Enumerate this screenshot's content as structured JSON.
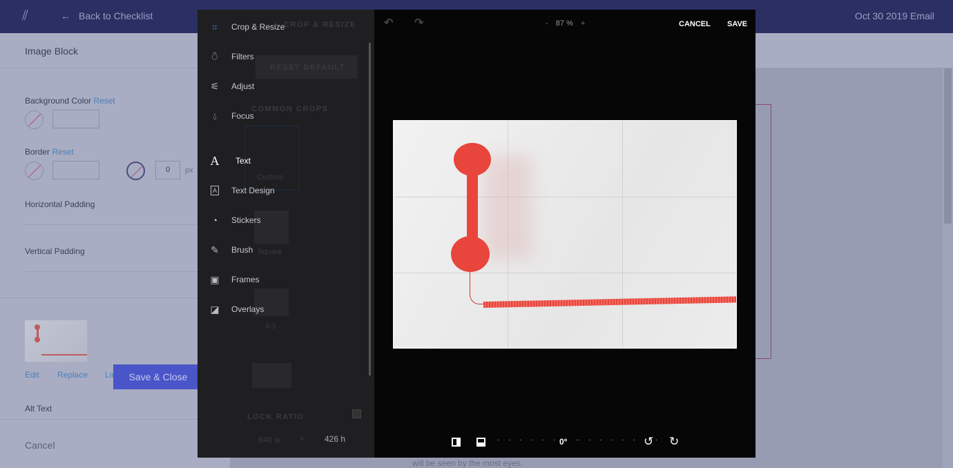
{
  "header": {
    "back_label": "Back to Checklist",
    "doc_title": "Oct 30 2019 Email"
  },
  "subheader": {
    "title": "Image Block"
  },
  "settings": {
    "background_color": {
      "label": "Background Color",
      "reset": "Reset"
    },
    "border": {
      "label": "Border",
      "reset": "Reset",
      "width": "0",
      "unit": "px"
    },
    "horizontal_padding": "Horizontal Padding",
    "vertical_padding": "Vertical Padding",
    "image_actions": {
      "edit": "Edit",
      "replace": "Replace",
      "link": "Link"
    },
    "alt_text": "Alt Text",
    "cancel": "Cancel",
    "save_close": "Save & Close"
  },
  "background_text": "will be seen by the most eyes.",
  "editor": {
    "tools": [
      {
        "label": "Crop & Resize",
        "icon": "crop-icon"
      },
      {
        "label": "Filters",
        "icon": "flask-icon"
      },
      {
        "label": "Adjust",
        "icon": "sliders-icon"
      },
      {
        "label": "Focus",
        "icon": "drop-icon"
      },
      {
        "label": "Text",
        "icon": "text-icon"
      },
      {
        "label": "Text Design",
        "icon": "bookmark-a-icon"
      },
      {
        "label": "Stickers",
        "icon": "sticker-icon"
      },
      {
        "label": "Brush",
        "icon": "brush-icon"
      },
      {
        "label": "Frames",
        "icon": "frame-icon"
      },
      {
        "label": "Overlays",
        "icon": "overlay-icon"
      }
    ],
    "active_tool": "Text",
    "behind_panel": {
      "heading": "CROP & RESIZE",
      "reset_default": "RESET DEFAULT",
      "common_crops": "COMMON CROPS",
      "crops": [
        "Custom",
        "Square",
        "4:3"
      ],
      "lock_ratio": "LOCK RATIO",
      "width": "640 w",
      "times": "×",
      "height": "426 h"
    },
    "zoom": {
      "minus": "-",
      "value": "87 %",
      "plus": "+"
    },
    "cancel": "CANCEL",
    "save": "SAVE",
    "rotation": "0°",
    "accent": "#e8453c"
  }
}
